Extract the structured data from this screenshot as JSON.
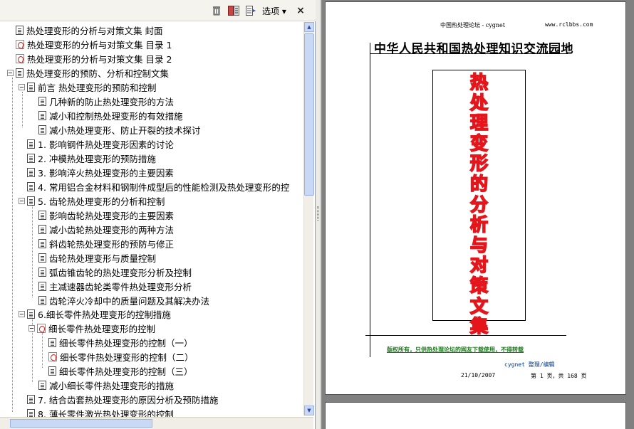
{
  "toolbar": {
    "options_label": "选项 ▾",
    "close_label": "×",
    "icons": [
      "delete-icon",
      "expand-bookmarks-icon",
      "bookmark-properties-icon"
    ]
  },
  "bookmarks": [
    {
      "label": "热处理变形的分析与对策文集 封面",
      "icon": "doc",
      "level": 0
    },
    {
      "label": "热处理变形的分析与对策文集 目录 1",
      "icon": "pdf",
      "level": 0
    },
    {
      "label": "热处理变形的分析与对策文集 目录 2",
      "icon": "pdf",
      "level": 0
    },
    {
      "label": "热处理变形的预防、分析和控制文集",
      "icon": "doc",
      "level": 0,
      "expanded": true
    },
    {
      "label": "前言  热处理变形的预防和控制",
      "icon": "doc",
      "level": 1,
      "expanded": true
    },
    {
      "label": "几种新的防止热处理变形的方法",
      "icon": "doc",
      "level": 2
    },
    {
      "label": "减小和控制热处理变形的有效措施",
      "icon": "doc",
      "level": 2
    },
    {
      "label": "减小热处理变形、防止开裂的技术探讨",
      "icon": "doc",
      "level": 2
    },
    {
      "label": "1. 影响钢件热处理变形因素的讨论",
      "icon": "doc",
      "level": 1
    },
    {
      "label": "2. 冲模热处理变形的预防措施",
      "icon": "doc",
      "level": 1
    },
    {
      "label": "3. 影响淬火热处理变形的主要因素",
      "icon": "doc",
      "level": 1
    },
    {
      "label": "4. 常用铝合金材料和钢制件成型后的性能检测及热处理变形的控",
      "icon": "doc",
      "level": 1
    },
    {
      "label": "5. 齿轮热处理变形的分析和控制",
      "icon": "doc",
      "level": 1,
      "expanded": true
    },
    {
      "label": "影响齿轮热处理变形的主要因素",
      "icon": "doc",
      "level": 2
    },
    {
      "label": "减小齿轮热处理变形的两种方法",
      "icon": "doc",
      "level": 2
    },
    {
      "label": "斜齿轮热处理变形的预防与修正",
      "icon": "doc",
      "level": 2
    },
    {
      "label": "齿轮热处理变形与质量控制",
      "icon": "doc",
      "level": 2
    },
    {
      "label": "弧齿锥齿轮的热处理变形分析及控制",
      "icon": "doc",
      "level": 2
    },
    {
      "label": "主减速器齿轮类零件热处理变形分析",
      "icon": "doc",
      "level": 2
    },
    {
      "label": "齿轮淬火冷却中的质量问题及其解决办法",
      "icon": "doc",
      "level": 2
    },
    {
      "label": "6.细长零件热处理变形的控制措施",
      "icon": "doc",
      "level": 1,
      "expanded": true
    },
    {
      "label": "细长零件热处理变形的控制",
      "icon": "pdf",
      "level": 2,
      "expanded": true
    },
    {
      "label": "细长零件热处理变形的控制（一）",
      "icon": "doc",
      "level": 3
    },
    {
      "label": "细长零件热处理变形的控制（二）",
      "icon": "pdf",
      "level": 3
    },
    {
      "label": "细长零件热处理变形的控制（三）",
      "icon": "doc",
      "level": 3
    },
    {
      "label": "减小细长零件热处理变形的措施",
      "icon": "doc",
      "level": 2
    },
    {
      "label": "7. 结合齿套热处理变形的原因分析及预防措施",
      "icon": "doc",
      "level": 1
    },
    {
      "label": "8. 薄长零件激光热处理变形的控制",
      "icon": "doc",
      "level": 1
    }
  ],
  "page": {
    "header_left": "中国热处理论坛 - cygnet",
    "header_right": "www.rclbbs.com",
    "title": "中华人民共和国热处理知识交流园地",
    "cover_title": "热处理变形的分析与对策文集",
    "copyright": "版权所有，只供热处理论坛的网友下载使用，不得转载",
    "editor": "cygnet 整理/编辑",
    "date": "21/10/2007",
    "page_info": "第 1 页，共 168 页"
  },
  "colors": {
    "cover_title_red": "#e4151b",
    "copyright_green": "#1a7a1a",
    "viewer_bg": "#808080",
    "scroll_blue": "#c9d8f5"
  }
}
